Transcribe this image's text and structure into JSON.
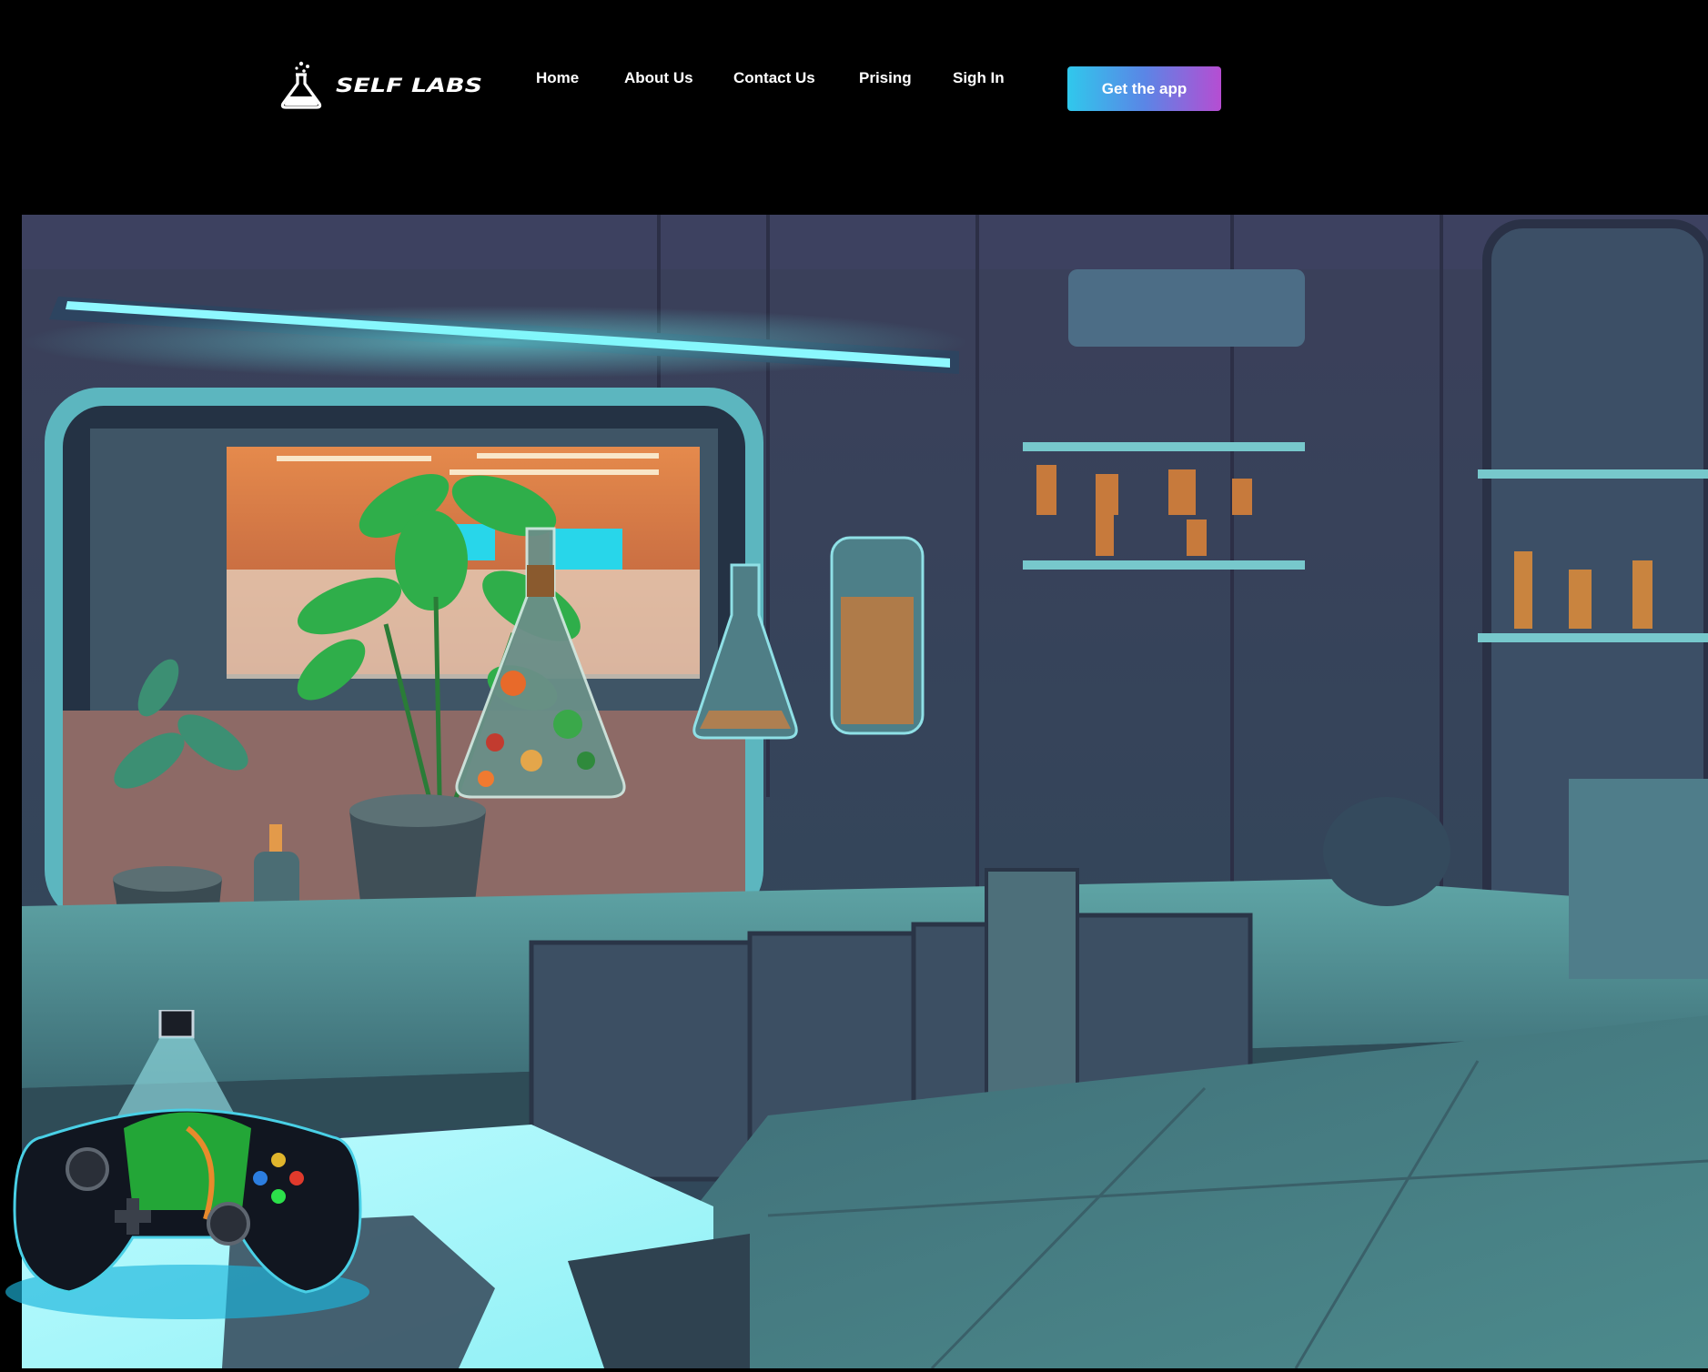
{
  "brand": {
    "logo_text": "SELF LABS",
    "logo_icon": "flask-icon"
  },
  "nav": {
    "items": [
      {
        "label": "Home"
      },
      {
        "label": "About Us"
      },
      {
        "label": "Contact Us"
      },
      {
        "label": "Prising"
      },
      {
        "label": "Sigh In"
      }
    ]
  },
  "cta": {
    "label": "Get the app",
    "gradient_start": "#30c8ec",
    "gradient_end": "#b64dd2"
  },
  "hero": {
    "image": "sci-fi-laboratory-illustration",
    "accent": "#5fe8ee"
  }
}
